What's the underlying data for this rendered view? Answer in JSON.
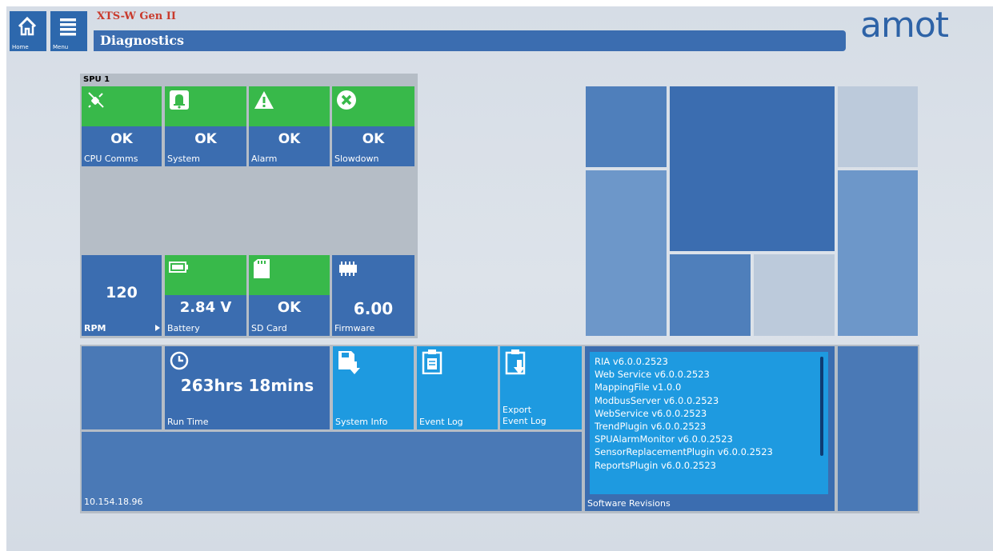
{
  "header": {
    "home_label": "Home",
    "menu_label": "Menu",
    "app_name": "XTS-W Gen II",
    "page_title": "Diagnostics",
    "logo_text": "amot"
  },
  "spu": {
    "label": "SPU 1",
    "status_tiles": [
      {
        "value": "OK",
        "label": "CPU Comms",
        "icon": "plug-disconnect-icon"
      },
      {
        "value": "OK",
        "label": "System",
        "icon": "bell-icon"
      },
      {
        "value": "OK",
        "label": "Alarm",
        "icon": "warning-icon"
      },
      {
        "value": "OK",
        "label": "Slowdown",
        "icon": "x-circle-icon"
      }
    ],
    "rpm": {
      "value": "120",
      "label": "RPM"
    },
    "battery": {
      "value": "2.84 V",
      "label": "Battery",
      "icon": "battery-icon"
    },
    "sd_card": {
      "value": "OK",
      "label": "SD Card",
      "icon": "sd-card-icon"
    },
    "firmware": {
      "value": "6.00",
      "label": "Firmware",
      "icon": "chip-icon"
    }
  },
  "runtime": {
    "value": "263hrs 18mins",
    "label": "Run Time",
    "icon": "clock-icon"
  },
  "actions": {
    "system_info": "System Info",
    "event_log": "Event Log",
    "export_line1": "Export",
    "export_line2": "Event Log"
  },
  "ip_address": "10.154.18.96",
  "software_revisions": {
    "label": "Software Revisions",
    "items": [
      "RIA v6.0.0.2523",
      "Web Service v6.0.0.2523",
      "MappingFile v1.0.0",
      "ModbusServer v6.0.0.2523",
      "WebService v6.0.0.2523",
      "TrendPlugin v6.0.0.2523",
      "SPUAlarmMonitor v6.0.0.2523",
      "SensorReplacementPlugin v6.0.0.2523",
      "ReportsPlugin v6.0.0.2523"
    ]
  },
  "colors": {
    "tile_blue": "#3b6db0",
    "tile_green": "#38b94a",
    "tile_light_blue": "#1e9ae0",
    "title_red": "#c93a2c"
  }
}
